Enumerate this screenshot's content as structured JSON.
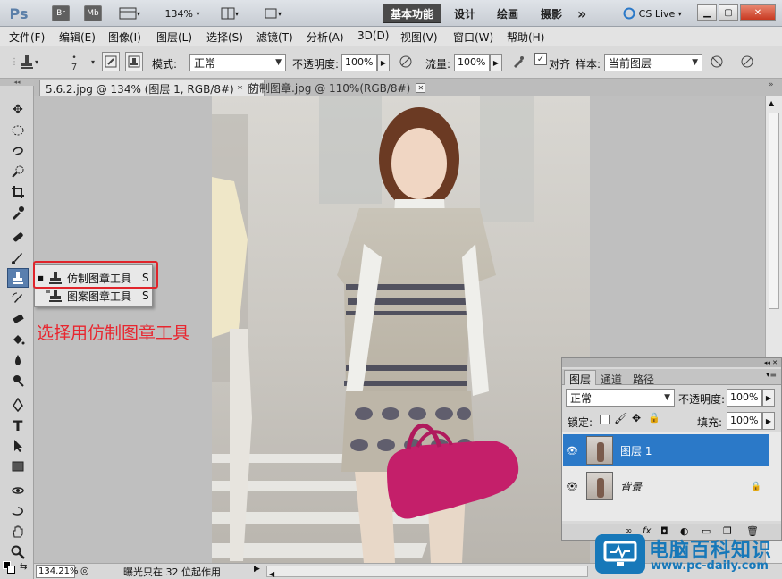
{
  "app": {
    "logo": "Ps",
    "bridge_label": "Br",
    "mini_bridge_label": "Mb",
    "zoom": "134%",
    "cs_live": "CS Live"
  },
  "workspaces": [
    {
      "label": "基本功能",
      "active": true
    },
    {
      "label": "设计",
      "active": false
    },
    {
      "label": "绘画",
      "active": false
    },
    {
      "label": "摄影",
      "active": false
    }
  ],
  "workspace_more": "»",
  "window_controls": {
    "minimize": "▁",
    "maximize": "▢",
    "close": "✕"
  },
  "menu": [
    "文件(F)",
    "编辑(E)",
    "图像(I)",
    "图层(L)",
    "选择(S)",
    "滤镜(T)",
    "分析(A)",
    "3D(D)",
    "视图(V)",
    "窗口(W)",
    "帮助(H)"
  ],
  "options": {
    "brush_size": "7",
    "mode_label": "模式:",
    "mode_value": "正常",
    "opacity_label": "不透明度:",
    "opacity_value": "100%",
    "flow_label": "流量:",
    "flow_value": "100%",
    "align_label": "对齐",
    "align_checked": true,
    "sample_label": "样本:",
    "sample_value": "当前图层"
  },
  "doc_tabs": [
    {
      "label": "5.6.2.jpg @ 134% (图层 1, RGB/8#) *",
      "active": true
    },
    {
      "label": "仿制图章.jpg @ 110%(RGB/8#)",
      "active": false
    }
  ],
  "flyout": {
    "items": [
      {
        "label": "仿制图章工具",
        "shortcut": "S",
        "selected": true
      },
      {
        "label": "图案图章工具",
        "shortcut": "S",
        "selected": false
      }
    ]
  },
  "annotation": "选择用仿制图章工具",
  "annotation_color": "#e8262f",
  "status": {
    "zoom": "134.21%",
    "message": "曝光只在 32 位起作用"
  },
  "layers_panel": {
    "tabs": [
      "图层",
      "通道",
      "路径"
    ],
    "blend_mode": "正常",
    "opacity_label": "不透明度:",
    "opacity_value": "100%",
    "lock_label": "锁定:",
    "fill_label": "填充:",
    "fill_value": "100%",
    "layers": [
      {
        "name": "图层 1",
        "selected": true
      },
      {
        "name": "背景",
        "selected": false
      }
    ]
  },
  "watermark": {
    "brand": "电脑百科知识",
    "url": "www.pc-daily.com"
  },
  "colors": {
    "selection": "#2b79c8",
    "tool_active": "#5a7fae",
    "highlight_red": "#e0242b"
  }
}
